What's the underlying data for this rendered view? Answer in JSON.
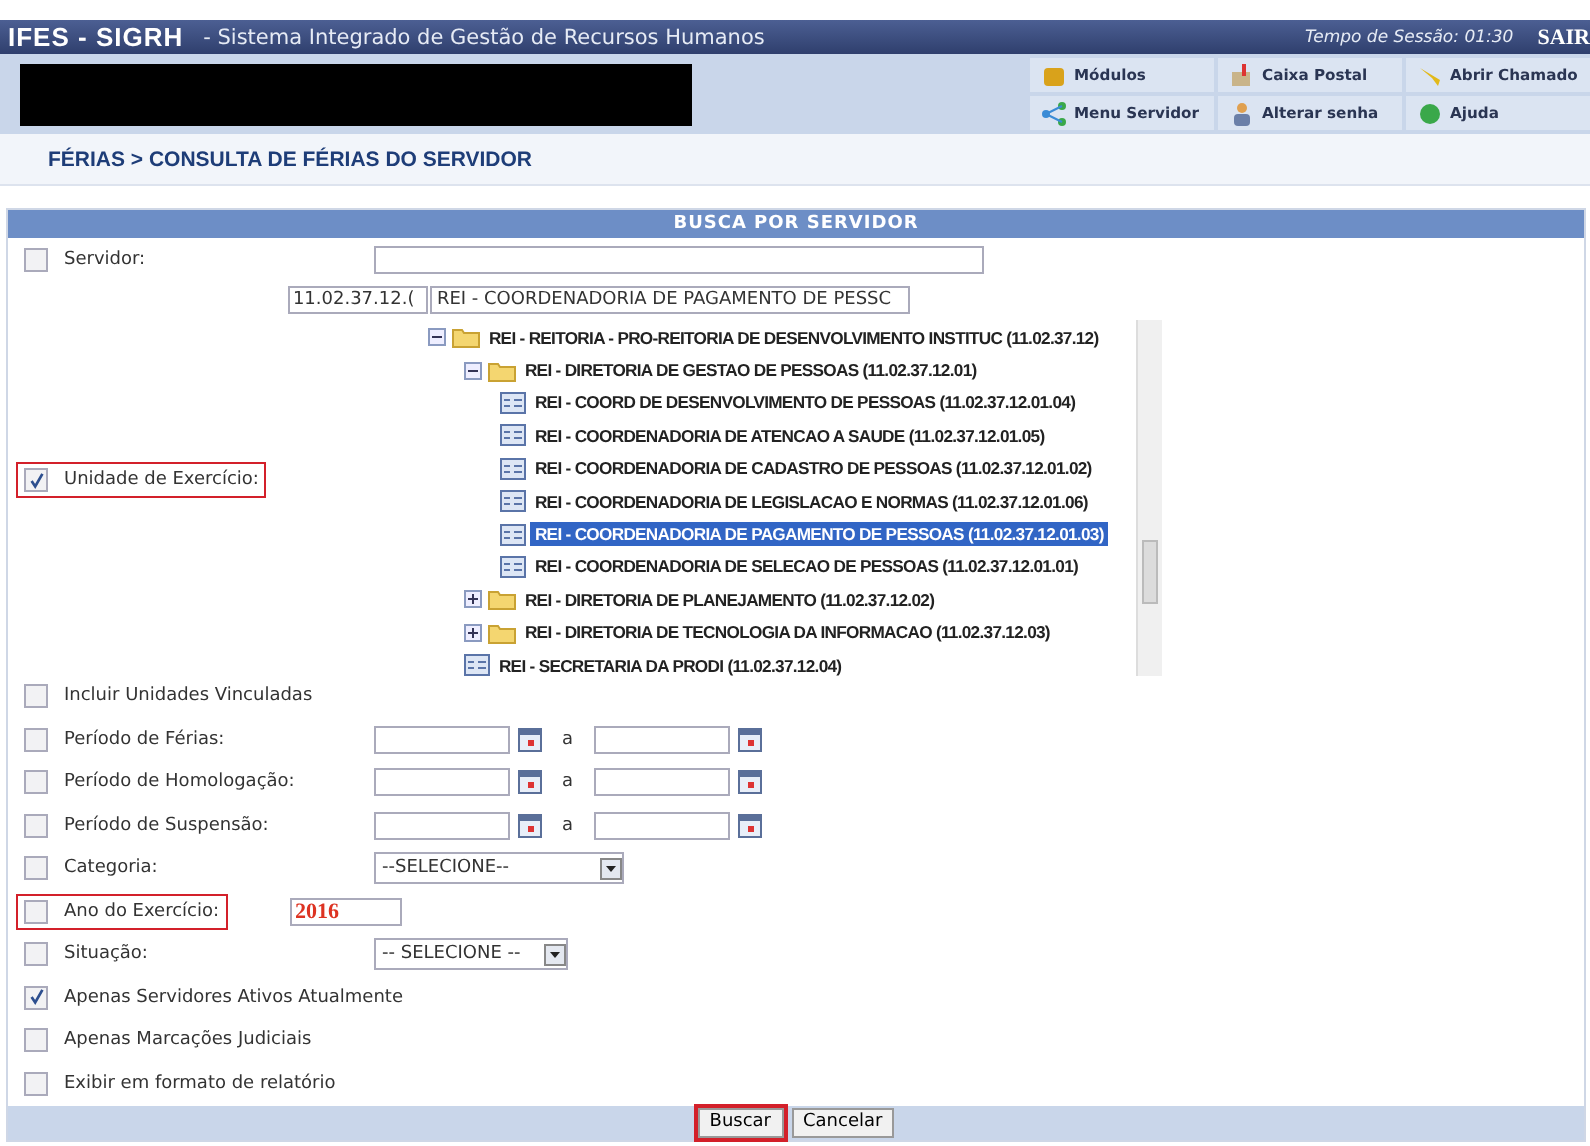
{
  "top_bar": {
    "system": "IFES - SIGRH",
    "subtitle": "- Sistema Integrado de Gestão de Recursos Humanos",
    "session": "Tempo de Sessão: 01:30",
    "logout": "SAIR"
  },
  "shortcuts": [
    {
      "label": "Módulos"
    },
    {
      "label": "Caixa Postal"
    },
    {
      "label": "Abrir Chamado"
    },
    {
      "label": "Menu Servidor"
    },
    {
      "label": "Alterar senha"
    },
    {
      "label": "Ajuda"
    }
  ],
  "breadcrumb": "FÉRIAS > CONSULTA DE FÉRIAS DO SERVIDOR",
  "form": {
    "title": "BUSCA POR SERVIDOR",
    "fields": [
      {
        "kind": "text",
        "label": "Servidor:",
        "checked": false,
        "highlighted": false
      },
      {
        "kind": "tree",
        "label": "Unidade de Exercício:",
        "checked": true,
        "highlighted": true,
        "code": "11.02.37.12.(",
        "unit": "REI - COORDENADORIA DE PAGAMENTO DE PESSC",
        "tree": [
          {
            "label": "REI - REITORIA - PRO-REITORIA DE DESENVOLVIMENTO INSTITUC (11.02.37.12)",
            "folder": true,
            "expanded": true,
            "selected": false,
            "children": [
              {
                "label": "REI - DIRETORIA DE GESTAO DE PESSOAS (11.02.37.12.01)",
                "folder": true,
                "expanded": true,
                "selected": false,
                "children": [
                  {
                    "label": "REI - COORD DE DESENVOLVIMENTO DE PESSOAS (11.02.37.12.01.04)",
                    "folder": false,
                    "selected": false
                  },
                  {
                    "label": "REI - COORDENADORIA DE ATENCAO A SAUDE (11.02.37.12.01.05)",
                    "folder": false,
                    "selected": false
                  },
                  {
                    "label": "REI - COORDENADORIA DE CADASTRO DE PESSOAS (11.02.37.12.01.02)",
                    "folder": false,
                    "selected": false
                  },
                  {
                    "label": "REI - COORDENADORIA DE LEGISLACAO E NORMAS (11.02.37.12.01.06)",
                    "folder": false,
                    "selected": false
                  },
                  {
                    "label": "REI - COORDENADORIA DE PAGAMENTO DE PESSOAS (11.02.37.12.01.03)",
                    "folder": false,
                    "selected": true
                  },
                  {
                    "label": "REI - COORDENADORIA DE SELECAO DE PESSOAS (11.02.37.12.01.01)",
                    "folder": false,
                    "selected": false
                  }
                ]
              },
              {
                "label": "REI - DIRETORIA DE PLANEJAMENTO (11.02.37.12.02)",
                "folder": true,
                "expanded": false,
                "selected": false
              },
              {
                "label": "REI - DIRETORIA DE TECNOLOGIA DA INFORMACAO (11.02.37.12.03)",
                "folder": true,
                "expanded": false,
                "selected": false
              },
              {
                "label": "REI - SECRETARIA DA PRODI (11.02.37.12.04)",
                "folder": false,
                "selected": false
              }
            ]
          }
        ]
      },
      {
        "kind": "flag",
        "label": "Incluir Unidades Vinculadas",
        "checked": false,
        "highlighted": false
      },
      {
        "kind": "date_range",
        "label": "Período de Férias:",
        "checked": false,
        "highlighted": false,
        "separator": "a"
      },
      {
        "kind": "date_range",
        "label": "Período de Homologação:",
        "checked": false,
        "highlighted": false,
        "separator": "a"
      },
      {
        "kind": "date_range",
        "label": "Período de Suspensão:",
        "checked": false,
        "highlighted": false,
        "separator": "a"
      },
      {
        "kind": "select",
        "label": "Categoria:",
        "checked": false,
        "highlighted": false,
        "value": "--SELECIONE--"
      },
      {
        "kind": "year",
        "label": "Ano do Exercício:",
        "checked": false,
        "highlighted": true,
        "value": "2016"
      },
      {
        "kind": "select",
        "label": "Situação:",
        "checked": false,
        "highlighted": false,
        "value": "-- SELECIONE --"
      },
      {
        "kind": "flag",
        "label": "Apenas Servidores Ativos Atualmente",
        "checked": true,
        "highlighted": false
      },
      {
        "kind": "flag",
        "label": "Apenas Marcações Judiciais",
        "checked": false,
        "highlighted": false
      },
      {
        "kind": "flag",
        "label": "Exibir em formato de relatório",
        "checked": false,
        "highlighted": false
      }
    ],
    "buttons": [
      {
        "label": "Buscar",
        "highlighted": true
      },
      {
        "label": "Cancelar",
        "highlighted": false
      }
    ]
  }
}
